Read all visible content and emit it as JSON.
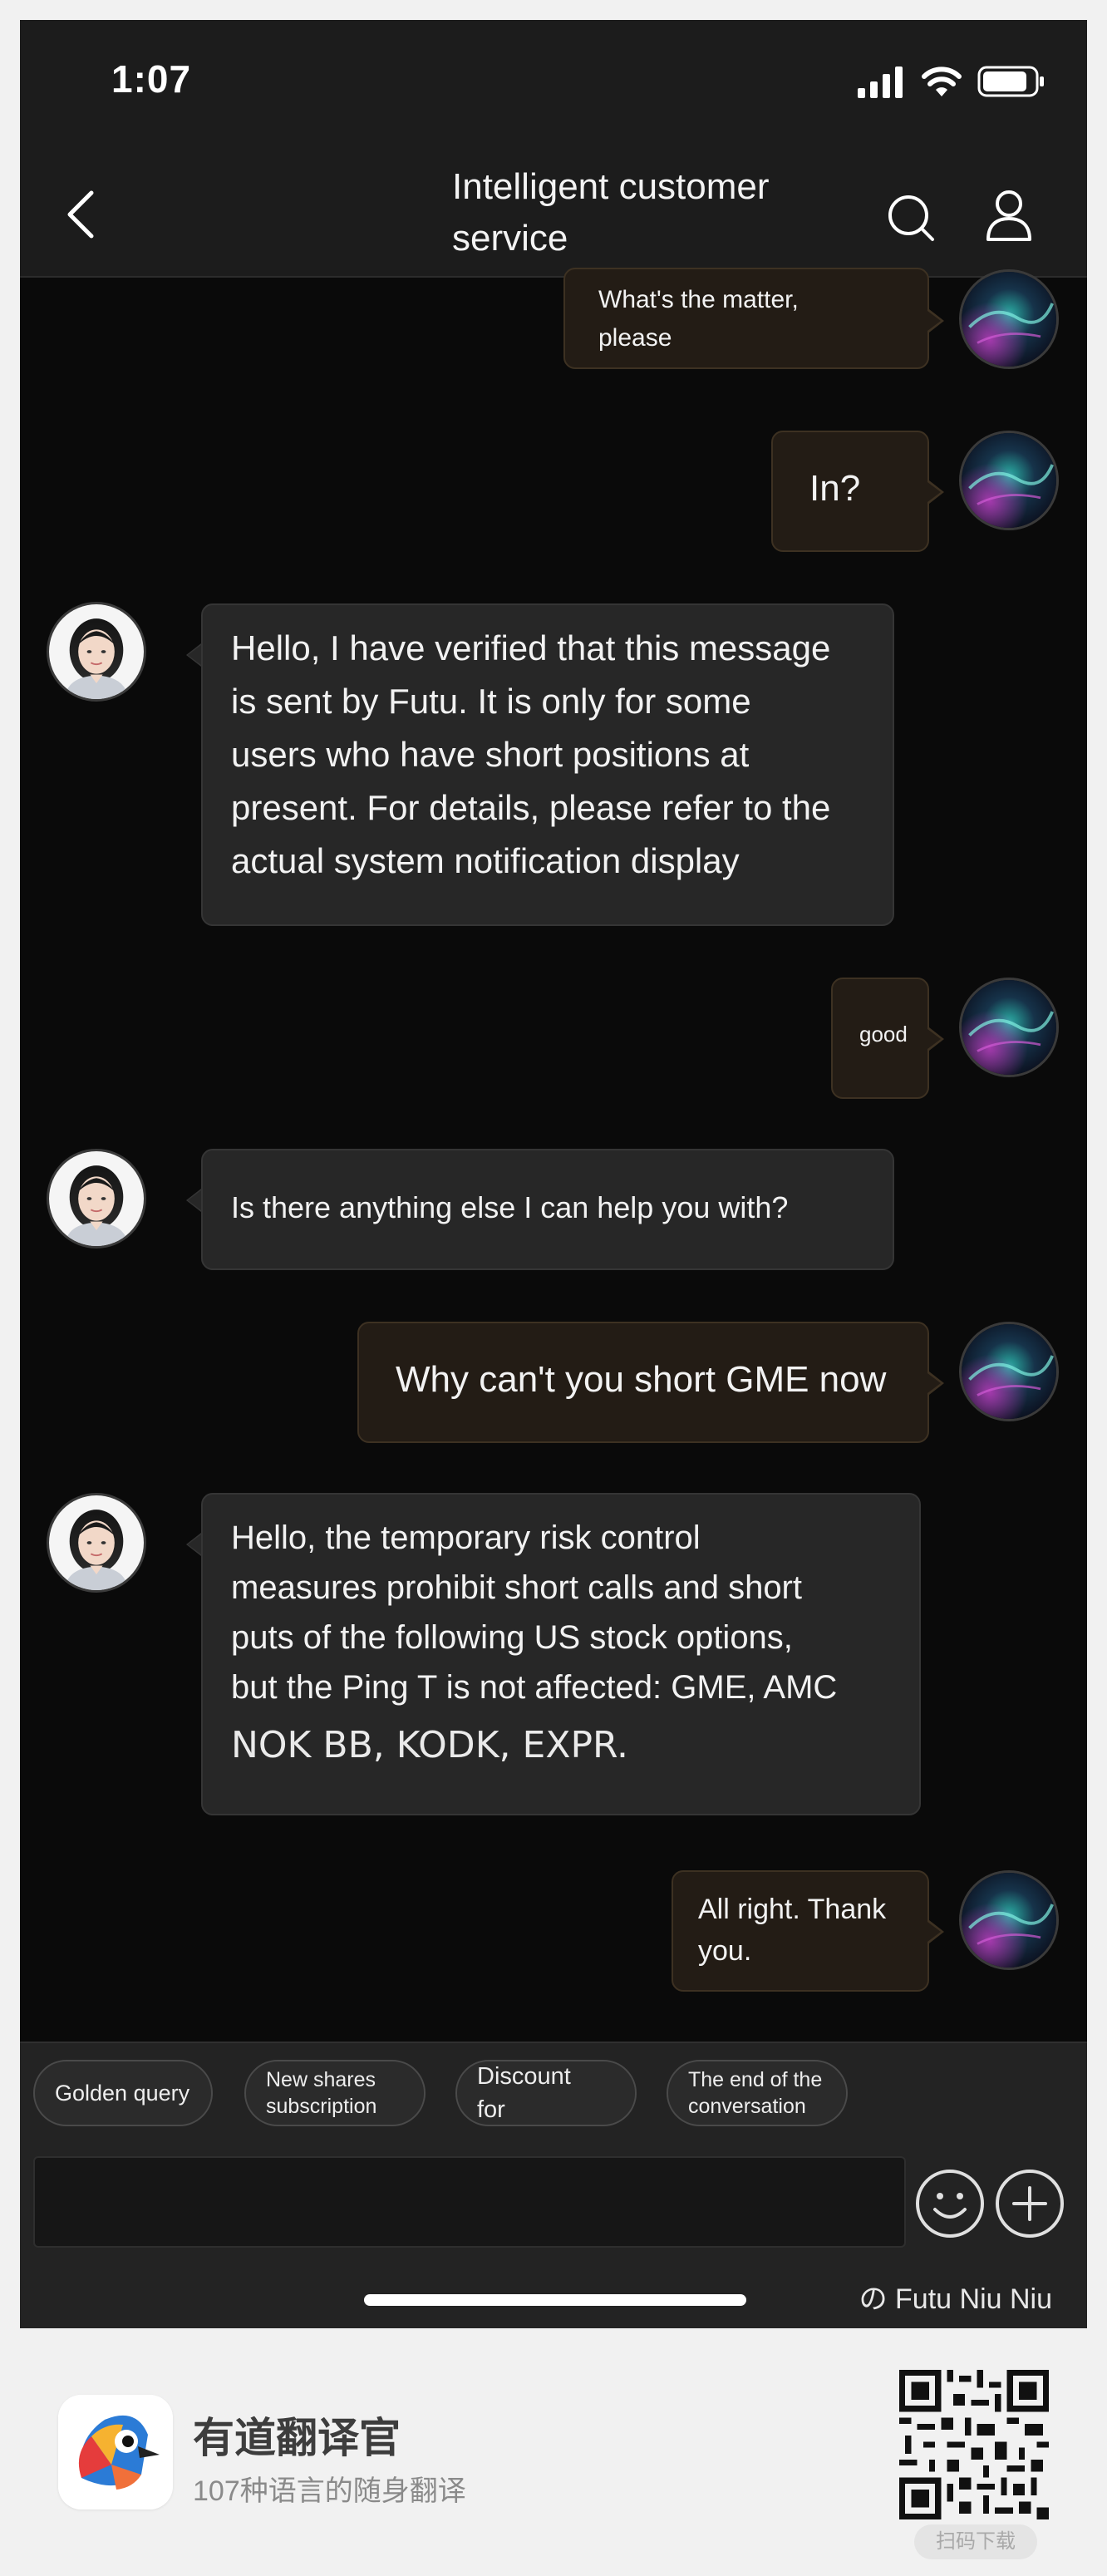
{
  "status_bar": {
    "time": "1:07"
  },
  "header": {
    "title": "Intelligent customer\nservice"
  },
  "messages": [
    {
      "from": "user",
      "text": "What's the matter,\nplease"
    },
    {
      "from": "user",
      "text": "In?"
    },
    {
      "from": "agent",
      "text": "Hello, I have verified that this message\n is sent by Futu. It is only for some\nusers who have short positions at\npresent. For details, please refer to the\n actual system notification display"
    },
    {
      "from": "user",
      "text": "good"
    },
    {
      "from": "agent",
      "text": "Is there anything else I can help you with?"
    },
    {
      "from": "user",
      "text": "Why can't you short GME now"
    },
    {
      "from": "agent",
      "text": "Hello, the temporary risk control\nmeasures prohibit short calls and short\nputs of the following US stock options,\nbut the Ping T is not affected: GME, AMC",
      "extra": " NOK BB, KODK, EXPR."
    },
    {
      "from": "user",
      "text": "All right. Thank\n you."
    }
  ],
  "quick_replies": [
    "Golden query",
    "New shares\nsubscription",
    "Discount\nfor",
    "The end of the\nconversation"
  ],
  "input": {
    "placeholder": ""
  },
  "watermark": "の Futu Niu Niu",
  "footer": {
    "app_name": "有道翻译官",
    "slogan": "107种语言的随身翻译",
    "qr_label": "扫码下载"
  }
}
